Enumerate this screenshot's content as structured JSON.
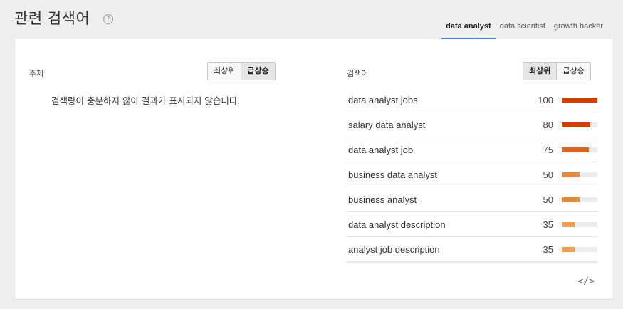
{
  "header": {
    "title": "관련 검색어",
    "help_icon": "?"
  },
  "tabs": [
    {
      "label": "data analyst",
      "active": true
    },
    {
      "label": "data scientist",
      "active": false
    },
    {
      "label": "growth hacker",
      "active": false
    }
  ],
  "topics_panel": {
    "label": "주제",
    "buttons": [
      "최상위",
      "급상승"
    ],
    "selected": "급상승",
    "empty_message": "검색량이 충분하지 않아 결과가 표시되지 않습니다."
  },
  "queries_panel": {
    "label": "검색어",
    "buttons": [
      "최상위",
      "급상승"
    ],
    "selected": "최상위",
    "rows": [
      {
        "term": "data analyst jobs",
        "value": 100,
        "color": "#cc3f00"
      },
      {
        "term": "salary data analyst",
        "value": 80,
        "color": "#cc3f00"
      },
      {
        "term": "data analyst job",
        "value": 75,
        "color": "#dd6524"
      },
      {
        "term": "business data analyst",
        "value": 50,
        "color": "#e48a3c"
      },
      {
        "term": "business analyst",
        "value": 50,
        "color": "#e48a3c"
      },
      {
        "term": "data analyst description",
        "value": 35,
        "color": "#eca04a"
      },
      {
        "term": "analyst job description",
        "value": 35,
        "color": "#eca04a"
      }
    ]
  },
  "embed_icon": "</>"
}
